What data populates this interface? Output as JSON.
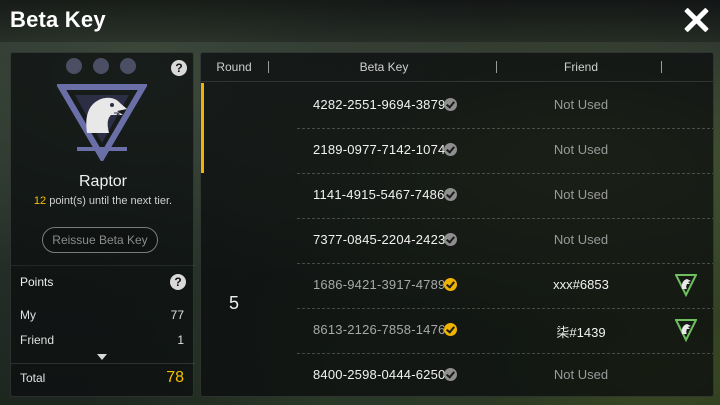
{
  "header": {
    "title": "Beta Key"
  },
  "profile": {
    "tier_name": "Raptor",
    "points_needed": "12",
    "points_suffix": " point(s) until the next tier.",
    "reissue_label": "Reissue Beta Key"
  },
  "points": {
    "title": "Points",
    "my_label": "My",
    "my_value": "77",
    "friend_label": "Friend",
    "friend_value": "1",
    "total_label": "Total",
    "total_value": "78"
  },
  "table": {
    "columns": {
      "round": "Round",
      "key": "Beta Key",
      "friend": "Friend"
    },
    "round_value": "5",
    "rows": [
      {
        "key": "4282-2551-9694-3879",
        "friend": "Not Used",
        "used": false
      },
      {
        "key": "2189-0977-7142-1074",
        "friend": "Not Used",
        "used": false
      },
      {
        "key": "1141-4915-5467-7486",
        "friend": "Not Used",
        "used": false
      },
      {
        "key": "7377-0845-2204-2423",
        "friend": "Not Used",
        "used": false
      },
      {
        "key": "1686-9421-3917-4789",
        "friend": "xxx#6853",
        "used": true
      },
      {
        "key": "8613-2126-7858-1476",
        "friend": "柒#1439",
        "used": true
      },
      {
        "key": "8400-2598-0444-6250",
        "friend": "Not Used",
        "used": false
      }
    ]
  },
  "colors": {
    "accent": "#f5c000",
    "check_gold": "#f0b400",
    "check_grey": "#8e8e8e",
    "tier_purple": "#6a6fa8"
  },
  "icons": {
    "close": "close-icon",
    "help": "help-icon",
    "emblem": "raptor-emblem",
    "friend_badge": "tier-badge-icon"
  }
}
